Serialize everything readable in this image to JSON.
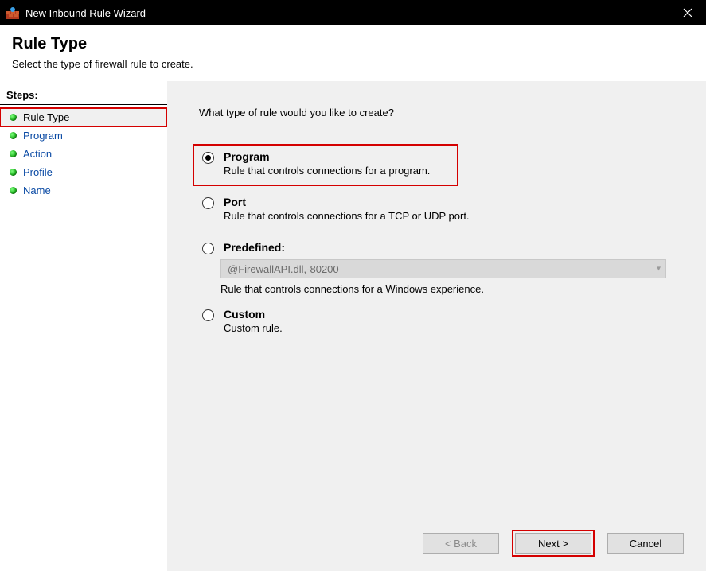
{
  "titlebar": {
    "title": "New Inbound Rule Wizard"
  },
  "header": {
    "heading": "Rule Type",
    "subtitle": "Select the type of firewall rule to create."
  },
  "sidebar": {
    "steps_label": "Steps:",
    "items": [
      {
        "label": "Rule Type"
      },
      {
        "label": "Program"
      },
      {
        "label": "Action"
      },
      {
        "label": "Profile"
      },
      {
        "label": "Name"
      }
    ]
  },
  "main": {
    "question": "What type of rule would you like to create?",
    "options": {
      "program": {
        "label": "Program",
        "desc": "Rule that controls connections for a program."
      },
      "port": {
        "label": "Port",
        "desc": "Rule that controls connections for a TCP or UDP port."
      },
      "predefined": {
        "label": "Predefined:",
        "combo_value": "@FirewallAPI.dll,-80200",
        "desc": "Rule that controls connections for a Windows experience."
      },
      "custom": {
        "label": "Custom",
        "desc": "Custom rule."
      }
    }
  },
  "footer": {
    "back": "< Back",
    "next": "Next >",
    "cancel": "Cancel"
  }
}
